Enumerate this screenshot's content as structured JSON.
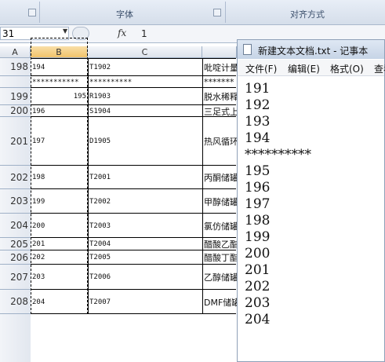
{
  "ribbon": {
    "groups": [
      {
        "label": "字体"
      },
      {
        "label": "对齐方式"
      }
    ]
  },
  "formula_bar": {
    "name_box": "31",
    "fx_label": "fx",
    "value": "1"
  },
  "columns": [
    "A",
    "B",
    "C"
  ],
  "rows": [
    {
      "num": "198",
      "b": "194",
      "c": "T1902",
      "d": "吡啶计量"
    },
    {
      "num": "",
      "b": "***********",
      "c": "**********",
      "d": "*******"
    },
    {
      "num": "199",
      "b": "195",
      "c": "R1903",
      "d": "脱水稀释"
    },
    {
      "num": "200",
      "b": "196",
      "c": "S1904",
      "d": "三足式上"
    },
    {
      "num": "201",
      "b": "197",
      "c": "D1905",
      "d": "热风循环"
    },
    {
      "num": "202",
      "b": "198",
      "c": "T2001",
      "d": "丙酮储罐"
    },
    {
      "num": "203",
      "b": "199",
      "c": "T2002",
      "d": "甲醇储罐"
    },
    {
      "num": "204",
      "b": "200",
      "c": "T2003",
      "d": "氯仿储罐"
    },
    {
      "num": "205",
      "b": "201",
      "c": "T2004",
      "d": "醋酸乙酯"
    },
    {
      "num": "206",
      "b": "202",
      "c": "T2005",
      "d": "醋酸丁酯"
    },
    {
      "num": "207",
      "b": "203",
      "c": "T2006",
      "d": "乙醇储罐"
    },
    {
      "num": "208",
      "b": "204",
      "c": "T2007",
      "d": "DMF储罐"
    }
  ],
  "notepad": {
    "title": "新建文本文档.txt - 记事本",
    "menu": [
      "文件(F)",
      "编辑(E)",
      "格式(O)",
      "查看"
    ],
    "lines": [
      "191",
      "192",
      "193",
      "194",
      "**********",
      "195",
      "196",
      "197",
      "198",
      "199",
      "200",
      "201",
      "202",
      "203",
      "204"
    ]
  }
}
